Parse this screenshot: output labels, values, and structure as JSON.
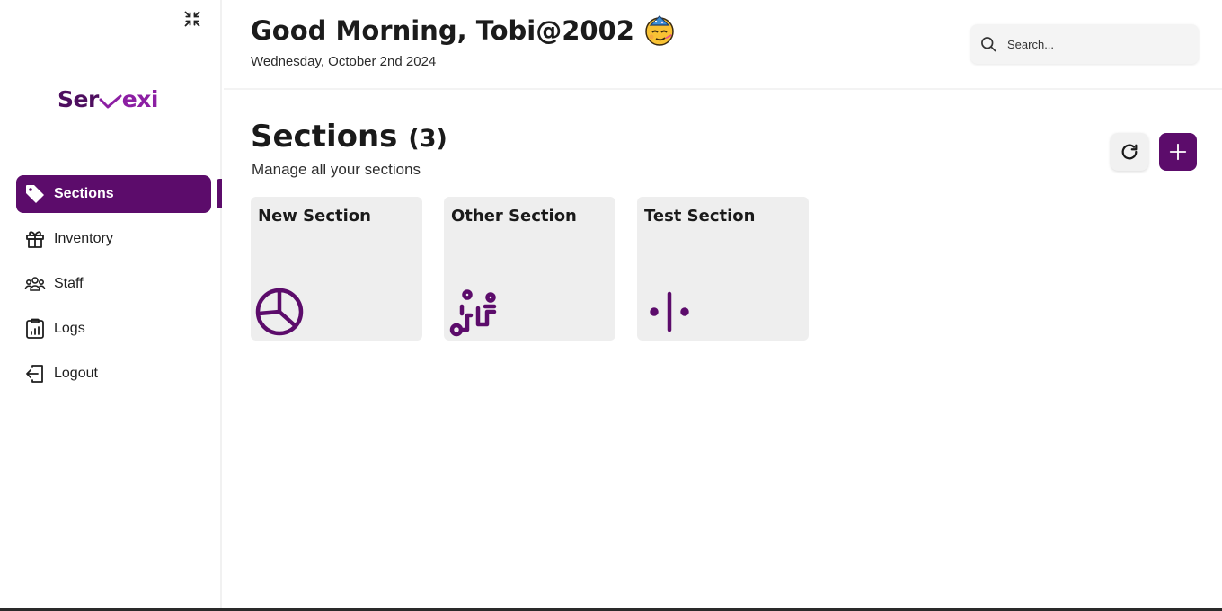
{
  "header": {
    "greeting": "Good Morning, Tobi@2002",
    "date": "Wednesday, October 2nd 2024",
    "search_placeholder": "Search..."
  },
  "logo": {
    "part1": "Ser",
    "part2": "exi"
  },
  "sidebar": {
    "items": [
      {
        "label": "Sections",
        "icon": "tag-icon",
        "active": true
      },
      {
        "label": "Inventory",
        "icon": "gift-icon",
        "active": false
      },
      {
        "label": "Staff",
        "icon": "users-icon",
        "active": false
      },
      {
        "label": "Logs",
        "icon": "clipboard-chart-icon",
        "active": false
      },
      {
        "label": "Logout",
        "icon": "logout-icon",
        "active": false
      }
    ]
  },
  "main": {
    "title": "Sections",
    "count": "(3)",
    "subtitle": "Manage all your sections",
    "sections": [
      {
        "title": "New Section",
        "icon": "pie-chart-icon"
      },
      {
        "title": "Other Section",
        "icon": "route-icon"
      },
      {
        "title": "Test Section",
        "icon": "separator-icon"
      }
    ]
  },
  "colors": {
    "accent": "#5c0c6b",
    "logo_dark": "#4e0e5f",
    "logo_light": "#8c1fa3",
    "card_bg": "#eeeeee"
  }
}
